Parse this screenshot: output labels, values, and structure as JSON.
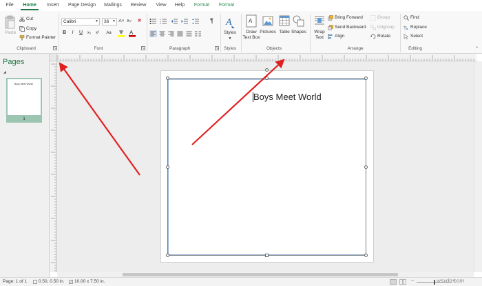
{
  "tabs": [
    {
      "label": "File"
    },
    {
      "label": "Home"
    },
    {
      "label": "Insert"
    },
    {
      "label": "Page Design"
    },
    {
      "label": "Mailings"
    },
    {
      "label": "Review"
    },
    {
      "label": "View"
    },
    {
      "label": "Help"
    },
    {
      "label": "Format"
    },
    {
      "label": "Format"
    }
  ],
  "clipboard": {
    "paste": "Paste",
    "cut": "Cut",
    "copy": "Copy",
    "format_painter": "Format Painter",
    "label": "Clipboard"
  },
  "font": {
    "name": "Calibri",
    "size": "36",
    "label": "Font",
    "grow": "A˄",
    "shrink": "A˅",
    "bold": "B",
    "italic": "I",
    "underline": "U",
    "x2_sub": "x₂",
    "x2_sup": "x²",
    "aa": "Aa",
    "highlight_color": "#ffff00",
    "font_color": "#c00000"
  },
  "paragraph": {
    "label": "Paragraph",
    "pilcrow": "¶"
  },
  "styles": {
    "button": "Styles",
    "label": "Styles"
  },
  "objects": {
    "draw_text_box_1": "Draw",
    "draw_text_box_2": "Text Box",
    "pictures": "Pictures",
    "table": "Table",
    "shapes": "Shapes",
    "label": "Objects"
  },
  "arrange": {
    "wrap_text_1": "Wrap",
    "wrap_text_2": "Text",
    "bring_forward": "Bring Forward",
    "send_backward": "Send Backward",
    "align": "Align",
    "group": "Group",
    "ungroup": "Ungroup",
    "rotate": "Rotate",
    "label": "Arrange"
  },
  "editing": {
    "find": "Find",
    "replace": "Replace",
    "select": "Select",
    "label": "Editing"
  },
  "pages_pane": {
    "title": "Pages",
    "thumb_title": "Boys Meet World",
    "page_number": "1"
  },
  "document": {
    "text": "Boys Meet World"
  },
  "status": {
    "page": "Page: 1 of 1",
    "position": "0.50, 0.50 in.",
    "size": "10.00 x 7.50 in."
  },
  "watermark": "wsxdn.com",
  "colors": {
    "accent": "#217346",
    "arrow": "#e02020",
    "guide": "#9ab8d8"
  }
}
